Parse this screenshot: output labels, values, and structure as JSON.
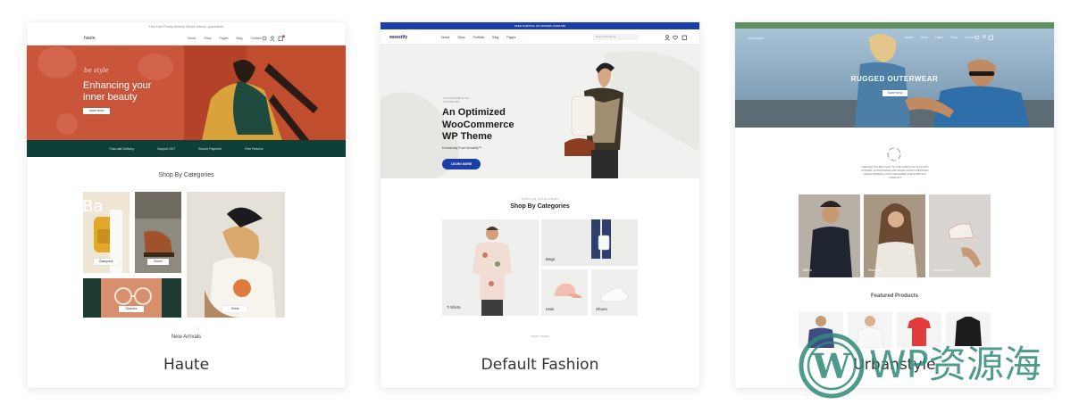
{
  "cards": [
    {
      "title": "Haute",
      "topline": "Free Fast Priority delivery, Simple returns, guaranteed",
      "logo": "haute",
      "menu": [
        "Home",
        "Shop",
        "Pages",
        "Blog",
        "Contact"
      ],
      "hero_script": "be style",
      "hero_heading_1": "Enhancing your",
      "hero_heading_2": "inner beauty",
      "hero_button": "SHOP NOW",
      "strip": [
        "Fast-rate Delivery",
        "Support 24/7",
        "Secure Payment",
        "Free Returns"
      ],
      "categories_title": "Shop By Categories",
      "categories": [
        "Backpack",
        "Shoes",
        "Glasses",
        "Shirts"
      ],
      "new_arrivals": "New Arrivals"
    },
    {
      "title": "Default Fashion",
      "topline": "FREE SHIPPING ON ORDERS OVER $50",
      "logo": "woostify",
      "menu": [
        "Home",
        "Shop",
        "Portfolio",
        "Blog",
        "Pages"
      ],
      "search_placeholder": "Search Products",
      "hero_kicker_1": "SUSTAINABLE BY",
      "hero_kicker_2": "STANDARD",
      "hero_heading_1": "An Optimized",
      "hero_heading_2": "WooCommerce",
      "hero_heading_3": "WP Theme",
      "hero_sub": "Exclusively From Woostify™",
      "hero_button": "LEARN MORE",
      "categories_kicker": "POPULAR CATEGORIES",
      "categories_title": "Shop By Categories",
      "categories": [
        "T-Shirts",
        "Bags",
        "Hats",
        "Shoes"
      ],
      "footer_kicker": "NEW ITEMS"
    },
    {
      "title": "Urbanstyle",
      "logo": "urbanstyle",
      "menu": [
        "Home",
        "Shop",
        "Pages",
        "Blog",
        "Contact"
      ],
      "hero_heading": "RUGGED OUTERWEAR",
      "hero_button": "SHOP NOW",
      "intro_text": "URBANSTYLE BROUGHT TO THE WORLD OF CLOTHING APPAREL ACCESSORIES AND MORE ALWAYS BRINGING FRESH MODERN LOOKS DESIGNED FOR EVERYDAY COMFORT",
      "categories": [
        "Mens",
        "Womens",
        "Accessories"
      ],
      "featured_title": "Featured Products"
    }
  ],
  "watermark": {
    "text": "WP资源海"
  },
  "colors": {
    "haute_accent": "#c9553a",
    "haute_strip": "#0f4038",
    "woostify_blue": "#1b3fa6",
    "urban_green": "#5f8f60",
    "watermark": "#2f8a7a"
  }
}
